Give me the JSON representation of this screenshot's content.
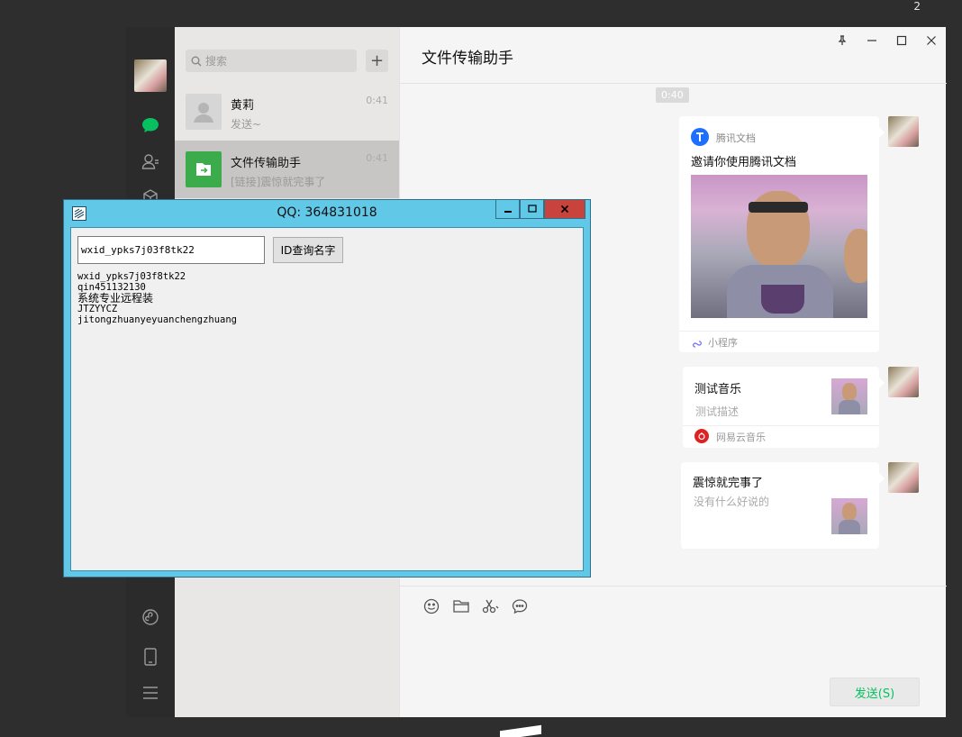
{
  "system": {
    "corner_count": "2"
  },
  "wechat": {
    "search": {
      "placeholder": "搜索"
    },
    "add_label": "+",
    "chats": [
      {
        "name": "黄莉",
        "preview": "发送~",
        "time": "0:41"
      },
      {
        "name": "文件传输助手",
        "preview": "[链接]震惊就完事了",
        "time": "0:41"
      }
    ],
    "main_title": "文件传输助手",
    "time_separator": "0:40",
    "messages": [
      {
        "source": "腾讯文档",
        "title": "邀请你使用腾讯文档",
        "footer": "小程序"
      },
      {
        "title": "测试音乐",
        "desc": "测试描述",
        "footer": "网易云音乐"
      },
      {
        "title": "震惊就完事了",
        "desc": "没有什么好说的"
      }
    ],
    "send_label": "发送(S)",
    "colors": {
      "accent": "#07c160",
      "sidebar": "#2b2b2b",
      "list_bg": "#e9e7e6"
    }
  },
  "tool_window": {
    "title": "QQ: 364831018",
    "input_value": "wxid_ypks7j03f8tk22",
    "query_button": "ID查询名字",
    "results": [
      "wxid_ypks7j03f8tk22",
      "qin451132130",
      "系统专业远程装",
      "JTZYYCZ",
      "jitongzhuanyeyuanchengzhuang"
    ],
    "colors": {
      "frame": "#62c8e8",
      "close": "#c8433c"
    }
  }
}
